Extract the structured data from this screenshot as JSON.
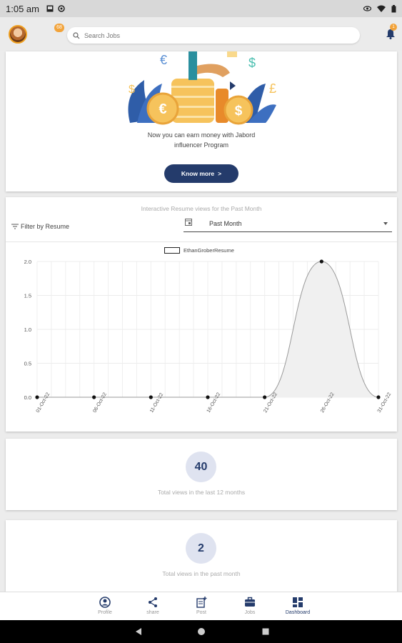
{
  "status_bar": {
    "time": "1:05 am"
  },
  "header": {
    "avatar_badge": "68",
    "search_placeholder": "Search Jobs",
    "bell_badge": "1"
  },
  "promo": {
    "line1": "Now you can earn money with Jabord",
    "line2": "influencer Program",
    "button_label": "Know more",
    "button_chevron": ">"
  },
  "chart_card": {
    "title": "Interactive Resume views for the Past Month",
    "filter_label": "Filter by Resume",
    "dropdown_value": "Past Month"
  },
  "chart_data": {
    "type": "area",
    "title": "Interactive Resume views for the Past Month",
    "series": [
      {
        "name": "EthanGroberResume",
        "values": [
          0,
          0,
          0,
          0,
          0,
          2,
          0
        ]
      }
    ],
    "x": [
      "01-Oct-22",
      "06-Oct-22",
      "11-Oct-22",
      "16-Oct-22",
      "21-Oct-22",
      "26-Oct-22",
      "31-Oct-22"
    ],
    "y_ticks": [
      "0.0",
      "0.5",
      "1.0",
      "1.5",
      "2.0"
    ],
    "ylim": [
      0,
      2
    ],
    "grid": true,
    "legend": "top-center",
    "colors": {
      "line": "#9a9a9a",
      "fill": "#f0f0f0",
      "point": "#111111"
    }
  },
  "stats": [
    {
      "value": "40",
      "label": "Total views in the last 12 months"
    },
    {
      "value": "2",
      "label": "Total views in the past month"
    }
  ],
  "bottom_nav": [
    {
      "label": "Profile",
      "icon": "profile-icon",
      "active": false
    },
    {
      "label": "share",
      "icon": "share-icon",
      "active": false
    },
    {
      "label": "Post",
      "icon": "post-icon",
      "active": false
    },
    {
      "label": "Jobs",
      "icon": "briefcase-icon",
      "active": false
    },
    {
      "label": "Dashboard",
      "icon": "dashboard-icon",
      "active": true
    }
  ],
  "colors": {
    "primary": "#243b6b",
    "accent": "#f2a33a"
  }
}
